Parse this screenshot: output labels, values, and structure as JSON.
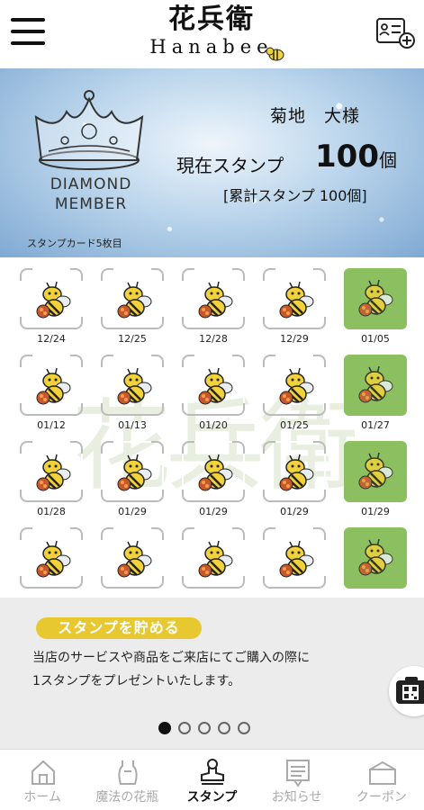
{
  "header": {
    "logo_kanji": "花兵衛",
    "logo_en": "Hanabee"
  },
  "banner": {
    "member_line1": "DIAMOND",
    "member_line2": "MEMBER",
    "user_name": "菊地　大様",
    "current_label": "現在スタンプ",
    "current_value": "100",
    "current_unit": "個",
    "total_label": "[累計スタンプ 100個]",
    "card_label": "スタンプカード5枚目"
  },
  "stamps": [
    {
      "date": "12/24",
      "type": "normal"
    },
    {
      "date": "12/25",
      "type": "normal"
    },
    {
      "date": "12/28",
      "type": "normal"
    },
    {
      "date": "12/29",
      "type": "normal"
    },
    {
      "date": "01/05",
      "type": "green"
    },
    {
      "date": "01/12",
      "type": "normal"
    },
    {
      "date": "01/13",
      "type": "normal"
    },
    {
      "date": "01/20",
      "type": "normal"
    },
    {
      "date": "01/25",
      "type": "normal"
    },
    {
      "date": "01/27",
      "type": "green"
    },
    {
      "date": "01/28",
      "type": "normal"
    },
    {
      "date": "01/29",
      "type": "normal"
    },
    {
      "date": "01/29",
      "type": "normal"
    },
    {
      "date": "01/29",
      "type": "normal"
    },
    {
      "date": "01/29",
      "type": "green"
    },
    {
      "date": "",
      "type": "normal"
    },
    {
      "date": "",
      "type": "normal"
    },
    {
      "date": "",
      "type": "normal"
    },
    {
      "date": "",
      "type": "normal"
    },
    {
      "date": "",
      "type": "green"
    }
  ],
  "info": {
    "pill": "スタンプを貯める",
    "desc_line1": "当店のサービスや商品をご来店にてご購入の際に",
    "desc_line2": "1スタンプをプレゼントいたします。",
    "page_count": 5,
    "active_page": 1
  },
  "nav": [
    {
      "label": "ホーム",
      "icon": "home-icon",
      "active": false
    },
    {
      "label": "魔法の花瓶",
      "icon": "vase-icon",
      "active": false
    },
    {
      "label": "スタンプ",
      "icon": "stamp-icon",
      "active": true
    },
    {
      "label": "お知らせ",
      "icon": "news-icon",
      "active": false
    },
    {
      "label": "クーポン",
      "icon": "coupon-icon",
      "active": false
    }
  ],
  "colors": {
    "accent_yellow": "#e8c830",
    "stamp_green": "#8bbf5f",
    "nav_inactive": "#aaaaaa"
  }
}
